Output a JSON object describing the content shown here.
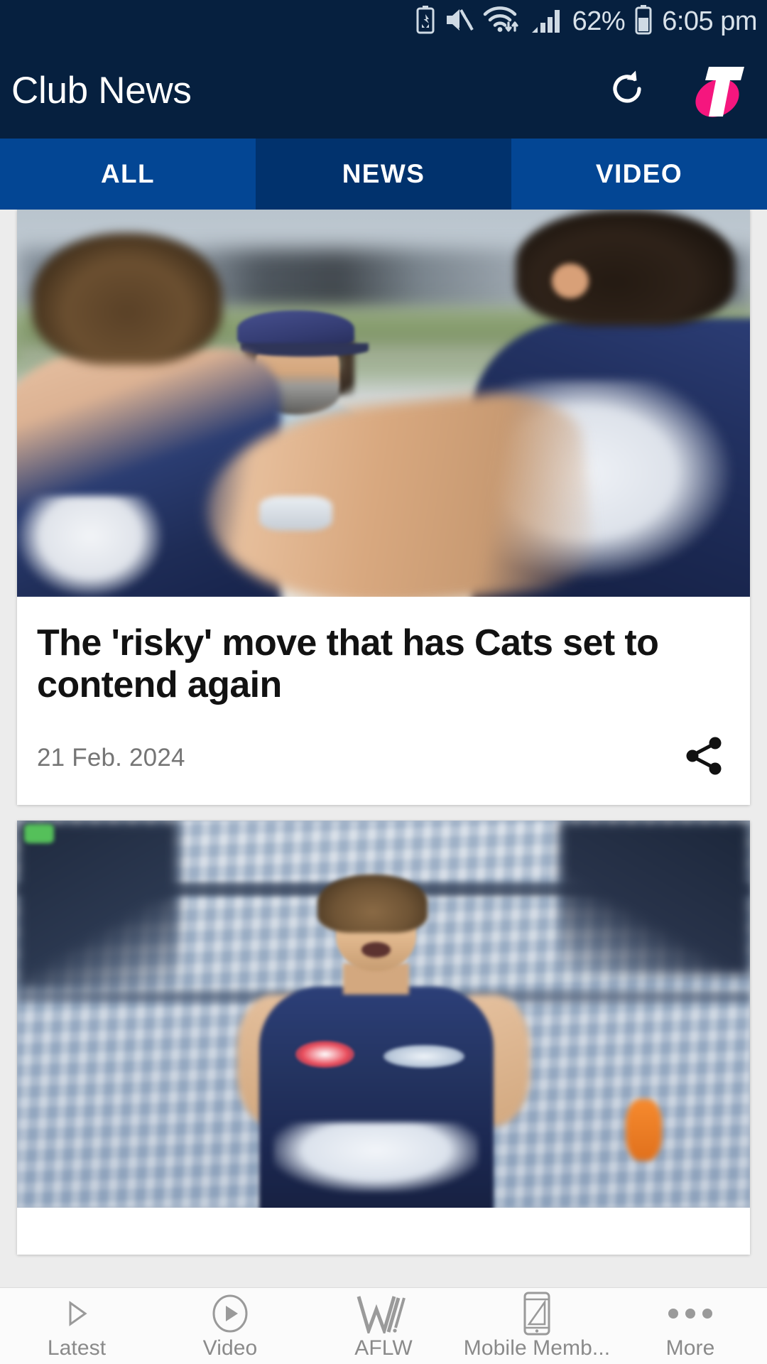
{
  "status_bar": {
    "battery_percent": "62%",
    "time": "6:05 pm",
    "icons": [
      "battery-saver-icon",
      "mute-icon",
      "wifi-icon",
      "signal-icon",
      "battery-icon"
    ]
  },
  "app_bar": {
    "title": "Club News",
    "refresh_icon": "refresh-icon",
    "brand_logo": "telstra-logo",
    "brand_color": "#f5167e",
    "background_color": "#06203f"
  },
  "tabs": {
    "items": [
      {
        "label": "ALL",
        "selected": false
      },
      {
        "label": "NEWS",
        "selected": true
      },
      {
        "label": "VIDEO",
        "selected": false
      }
    ],
    "active_color": "#01326d",
    "inactive_color": "#034694"
  },
  "feed": {
    "articles": [
      {
        "title": "The 'risky' move that has Cats set to contend again",
        "date": "21 Feb. 2024",
        "share_icon": "share-icon",
        "image_alt": "Geelong Cats coach Chris Scott talking to players at training"
      },
      {
        "title": "",
        "date": "",
        "share_icon": "share-icon",
        "image_alt": "Geelong Cats player in stadium"
      }
    ]
  },
  "bottom_nav": {
    "items": [
      {
        "label": "Latest",
        "icon": "play-outline-icon"
      },
      {
        "label": "Video",
        "icon": "play-circle-icon"
      },
      {
        "label": "AFLW",
        "icon": "aflw-icon"
      },
      {
        "label": "Mobile Memb...",
        "icon": "mobile-phone-icon"
      },
      {
        "label": "More",
        "icon": "more-dots-icon"
      }
    ],
    "label_color": "#8a8a8a"
  }
}
